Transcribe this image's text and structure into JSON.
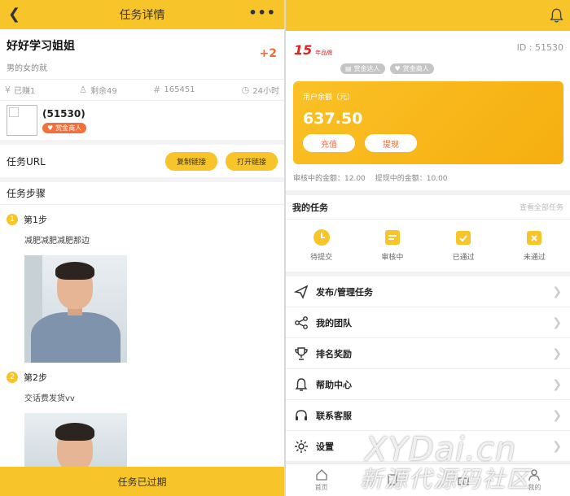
{
  "left": {
    "header": {
      "title": "任务详情",
      "back_icon": "chevron-left-icon",
      "more_icon": "more-icon"
    },
    "task": {
      "name": "好好学习姐姐",
      "desc": "男的女的就",
      "reward": "+2"
    },
    "stats": [
      {
        "icon": "yen-icon",
        "glyph": "¥",
        "text": "已赚1"
      },
      {
        "icon": "user-icon",
        "glyph": "♙",
        "text": "剩余49"
      },
      {
        "icon": "hash-icon",
        "glyph": "#",
        "text": "165451"
      },
      {
        "icon": "clock-icon",
        "glyph": "◷",
        "text": "24小时"
      }
    ],
    "publisher": {
      "name": "(51530)",
      "tag": "赏金商人"
    },
    "url_row": {
      "label": "任务URL",
      "copy_label": "复制链接",
      "open_label": "打开链接"
    },
    "steps_title": "任务步骤",
    "steps": [
      {
        "num": "1",
        "title": "第1步",
        "text": "减肥减肥减肥那边"
      },
      {
        "num": "2",
        "title": "第2步",
        "text": "交话费发货vv"
      }
    ],
    "footer": "任务已过期"
  },
  "right": {
    "logo": {
      "big": "15",
      "small": "年品牌"
    },
    "badges": [
      "赏金达人",
      "赏金商人"
    ],
    "uid": "ID : 51530",
    "card": {
      "label": "用户余额（元）",
      "amount": "637.50",
      "recharge": "充值",
      "withdraw": "提现"
    },
    "pending": {
      "review": "审核中的金额：12.00",
      "withdrawing": "提现中的金额：10.00"
    },
    "my_tasks": {
      "title": "我的任务",
      "all": "查看全部任务",
      "items": [
        {
          "label": "待提交",
          "icon": "clock-icon"
        },
        {
          "label": "审核中",
          "icon": "document-icon"
        },
        {
          "label": "已通过",
          "icon": "check-doc-icon"
        },
        {
          "label": "未通过",
          "icon": "reject-doc-icon"
        }
      ]
    },
    "menu": [
      {
        "label": "发布/管理任务",
        "icon": "send-icon"
      },
      {
        "label": "我的团队",
        "icon": "share-icon"
      },
      {
        "label": "排名奖励",
        "icon": "trophy-icon"
      },
      {
        "label": "帮助中心",
        "icon": "bell-icon"
      },
      {
        "label": "联系客服",
        "icon": "headset-icon"
      },
      {
        "label": "设置",
        "icon": "gear-icon"
      }
    ],
    "tabs": [
      {
        "label": "首页",
        "icon": "home-icon"
      },
      {
        "label": "",
        "icon": "task-icon"
      },
      {
        "label": "",
        "icon": "gift-icon"
      },
      {
        "label": "我的",
        "icon": "user-icon"
      }
    ],
    "colors": {
      "accent": "#f7c42a",
      "orange": "#f26b3a"
    }
  },
  "watermark": {
    "line1": "XYDai.cn",
    "line2": "新源代源码社区"
  }
}
